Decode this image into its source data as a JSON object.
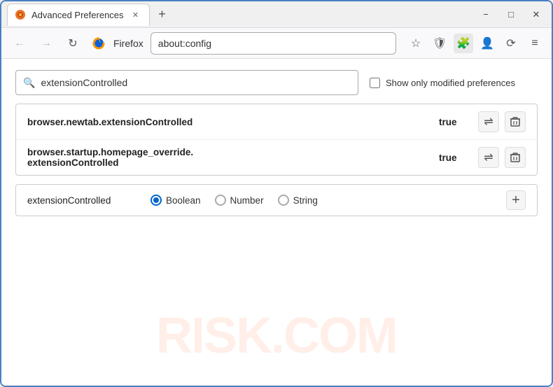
{
  "window": {
    "title": "Advanced Preferences",
    "tab_label": "Advanced Preferences",
    "address": "about:config"
  },
  "titlebar": {
    "tab_label": "Advanced Preferences",
    "new_tab_icon": "+",
    "minimize": "−",
    "maximize": "□",
    "close": "✕"
  },
  "navbar": {
    "back_icon": "←",
    "forward_icon": "→",
    "reload_icon": "↻",
    "browser_name": "Firefox",
    "address": "about:config",
    "bookmark_icon": "☆",
    "shield_icon": "🛡",
    "extensions_icon": "🧩",
    "profile_icon": "👤",
    "sync_icon": "⟳",
    "menu_icon": "≡"
  },
  "search": {
    "placeholder": "",
    "value": "extensionControlled",
    "search_icon": "🔍",
    "checkbox_label": "Show only modified preferences"
  },
  "preferences": {
    "rows": [
      {
        "name": "browser.newtab.extensionControlled",
        "value": "true"
      },
      {
        "name": "browser.startup.homepage_override.\nextensionControlled",
        "name_line1": "browser.startup.homepage_override.",
        "name_line2": "extensionControlled",
        "value": "true"
      }
    ],
    "toggle_icon": "⇌",
    "delete_icon": "🗑"
  },
  "add_preference": {
    "name": "extensionControlled",
    "type_options": [
      "Boolean",
      "Number",
      "String"
    ],
    "selected_type": "Boolean",
    "add_icon": "+"
  },
  "watermark": "RISK.COM"
}
